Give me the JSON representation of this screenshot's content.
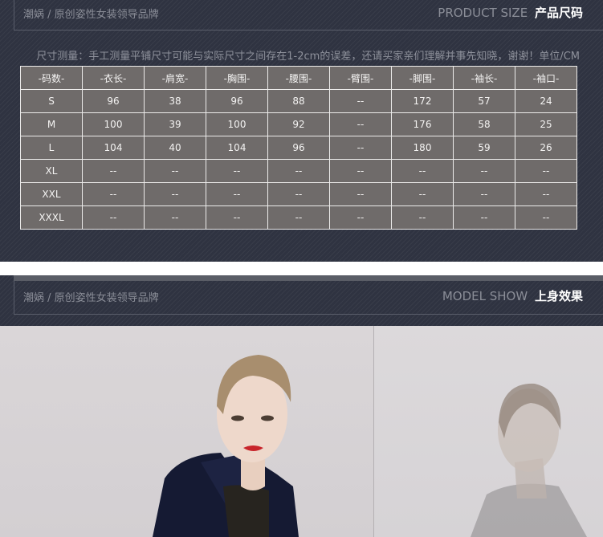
{
  "size_section": {
    "brand_text": "潮娲 / 原创姿性女装领导品牌",
    "title_en": "PRODUCT SIZE",
    "title_cn": "产品尺码",
    "note": "尺寸测量：手工测量平铺尺寸可能与实际尺寸之间存在1-2cm的误差，还请买家亲们理解并事先知晓，谢谢！单位/CM",
    "headers": [
      "-码数-",
      "-衣长-",
      "-肩宽-",
      "-胸围-",
      "-腰围-",
      "-臂围-",
      "-脚围-",
      "-袖长-",
      "-袖口-"
    ],
    "rows": [
      [
        "S",
        "96",
        "38",
        "96",
        "88",
        "--",
        "172",
        "57",
        "24"
      ],
      [
        "M",
        "100",
        "39",
        "100",
        "92",
        "--",
        "176",
        "58",
        "25"
      ],
      [
        "L",
        "104",
        "40",
        "104",
        "96",
        "--",
        "180",
        "59",
        "26"
      ],
      [
        "XL",
        "--",
        "--",
        "--",
        "--",
        "--",
        "--",
        "--",
        "--"
      ],
      [
        "XXL",
        "--",
        "--",
        "--",
        "--",
        "--",
        "--",
        "--",
        "--"
      ],
      [
        "XXXL",
        "--",
        "--",
        "--",
        "--",
        "--",
        "--",
        "--",
        "--"
      ]
    ]
  },
  "model_section": {
    "brand_text": "潮娲 / 原创姿性女装领导品牌",
    "title_en": "MODEL SHOW",
    "title_cn": "上身效果"
  },
  "colors": {
    "header_bg": "#2f3341",
    "table_bg": "#6f6b6a",
    "table_border": "#ecebea",
    "accent_text": "#ffffff",
    "muted_text": "#8a8d97"
  }
}
